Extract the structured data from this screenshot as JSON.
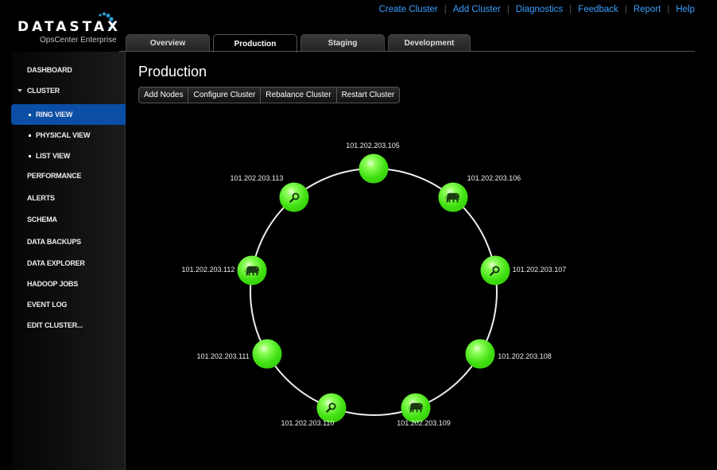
{
  "brand": {
    "name": "DATASTAX",
    "subtitle": "OpsCenter Enterprise"
  },
  "top_links": [
    "Create Cluster",
    "Add Cluster",
    "Diagnostics",
    "Feedback",
    "Report",
    "Help"
  ],
  "tabs": [
    {
      "label": "Overview",
      "active": false
    },
    {
      "label": "Production",
      "active": true
    },
    {
      "label": "Staging",
      "active": false
    },
    {
      "label": "Development",
      "active": false
    }
  ],
  "sidebar": {
    "items": [
      {
        "label": "DASHBOARD"
      },
      {
        "label": "CLUSTER",
        "expanded": true
      },
      {
        "label": "RING VIEW",
        "sub": true,
        "active": true
      },
      {
        "label": "PHYSICAL VIEW",
        "sub": true
      },
      {
        "label": "LIST VIEW",
        "sub": true
      },
      {
        "label": "PERFORMANCE"
      },
      {
        "label": "ALERTS"
      },
      {
        "label": "SCHEMA"
      },
      {
        "label": "DATA BACKUPS"
      },
      {
        "label": "DATA EXPLORER"
      },
      {
        "label": "HADOOP JOBS"
      },
      {
        "label": "EVENT LOG"
      },
      {
        "label": "EDIT CLUSTER..."
      }
    ]
  },
  "main": {
    "title": "Production",
    "actions": [
      "Add Nodes",
      "Configure Cluster",
      "Rebalance Cluster",
      "Restart Cluster"
    ]
  },
  "ring": {
    "node_color": "#40e010",
    "nodes": [
      {
        "ip": "101.202.203.105",
        "type": "cassandra"
      },
      {
        "ip": "101.202.203.106",
        "type": "hadoop"
      },
      {
        "ip": "101.202.203.107",
        "type": "search"
      },
      {
        "ip": "101.202.203.108",
        "type": "cassandra"
      },
      {
        "ip": "101.202.203.109",
        "type": "hadoop"
      },
      {
        "ip": "101.202.203.110",
        "type": "search"
      },
      {
        "ip": "101.202.203.111",
        "type": "cassandra"
      },
      {
        "ip": "101.202.203.112",
        "type": "hadoop"
      },
      {
        "ip": "101.202.203.113",
        "type": "search"
      }
    ]
  }
}
